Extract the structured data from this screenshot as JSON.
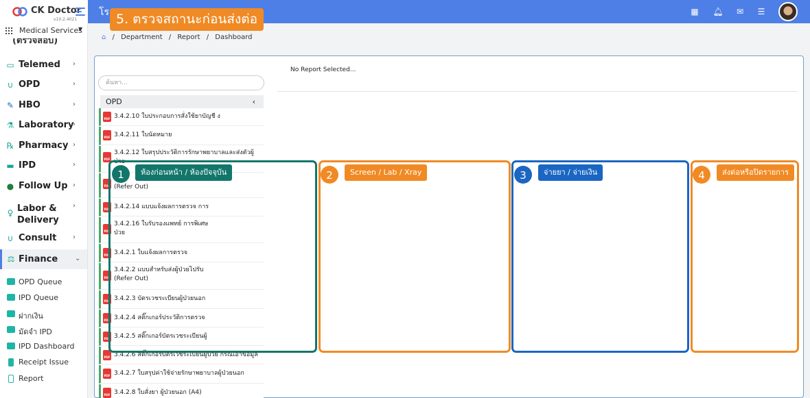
{
  "app": {
    "name": "CK Doctor",
    "version": "v10.2.4021",
    "hospital_title": "โรง"
  },
  "callout_step5": "5. ตรวจสถานะก่อนส่งต่อ",
  "sidebar": {
    "service_selector": "Medical Services",
    "cut_text": "(ตรวจสอบ)",
    "items": [
      {
        "label": "Telemed",
        "icon": "video-icon"
      },
      {
        "label": "OPD",
        "icon": "stethoscope-icon"
      },
      {
        "label": "HBO",
        "icon": "leaf-icon"
      },
      {
        "label": "Laboratory",
        "icon": "flask-icon"
      },
      {
        "label": "Pharmacy",
        "icon": "pill-icon"
      },
      {
        "label": "IPD",
        "icon": "bed-icon"
      },
      {
        "label": "Follow Up",
        "icon": "user-check-icon"
      },
      {
        "label": "Labor &",
        "label2": "Delivery",
        "icon": "baby-icon"
      },
      {
        "label": "Consult",
        "icon": "stethoscope-icon"
      },
      {
        "label": "Finance",
        "icon": "finance-icon"
      }
    ],
    "finance_sub": [
      {
        "label": "OPD Queue"
      },
      {
        "label": "IPD Queue"
      },
      {
        "label": "ฝากเงิน"
      },
      {
        "label": "มัดจำ IPD"
      },
      {
        "label": "IPD Dashboard"
      },
      {
        "label": "Receipt Issue"
      },
      {
        "label": "Report"
      }
    ]
  },
  "breadcrumb": [
    "Department",
    "Report",
    "Dashboard"
  ],
  "search_placeholder": "ค้นหา...",
  "no_report": "No Report Selected...",
  "opd_header": "OPD",
  "reports": [
    "3.4.2.10 ใบประกอบการสั่งใช้ยาบัญชี ง",
    "3.4.2.11 ใบนัดหมาย",
    "3.4.2.12 ใบสรุปประวัติการรักษาพยาบาลและส่งตัวผู้ป่วย",
    "(Refer Out)",
    "3.4.2.14 แบบแจ้งผลการตรวจ การ",
    "3.4.2.16 ใบรับรองแพทย์ การพิเศษ",
    "ป่วย",
    "3.4.2.1 ใบแจ้งผลการตรวจ",
    "3.4.2.2 แบบสำหรับส่งผู้ป่วยไปรับ",
    "(Refer Out)",
    "3.4.2.3 บัตรเวชระเบียนผู้ป่วยนอก",
    "3.4.2.4 สติ๊กเกอร์ประวัติการตรวจ",
    "3.4.2.5 สติ๊กเกอร์บัตรเวชระเบียนผู้",
    "3.4.2.6 สติ๊กเกอร์บัตรเวชระเบียนผู้ป่วย กรณีเอาข้อมูล",
    "3.4.2.7 ใบสรุปค่าใช้จ่ายรักษาพยาบาลผู้ป่วยนอก",
    "3.4.2.8 ใบสั่งยา ผู้ป่วยนอก (A4)"
  ],
  "zones": [
    {
      "num": "1",
      "label": "ห้องก่อนหน้า / ห้องปัจจุบัน",
      "color": "#12766a"
    },
    {
      "num": "2",
      "label": "Screen / Lab / Xray",
      "color": "#f08a24"
    },
    {
      "num": "3",
      "label": "จ่ายยา / จ่ายเงิน",
      "color": "#1a66c2"
    },
    {
      "num": "4",
      "label": "ส่งต่อหรือปิดรายการ",
      "color": "#f08a24"
    }
  ]
}
